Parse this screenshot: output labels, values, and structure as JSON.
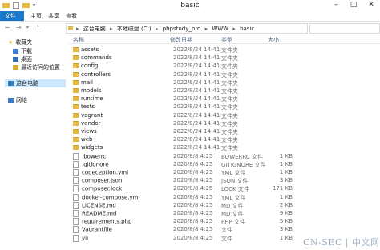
{
  "window": {
    "title": "basic",
    "controls": [
      "–",
      "□",
      "✕"
    ]
  },
  "ribbon": {
    "tabs": [
      "文件",
      "主页",
      "共享",
      "查看"
    ]
  },
  "address": {
    "crumbs": [
      "这台电脑",
      "本地磁盘 (C:)",
      "phpstudy_pro",
      "WWW",
      "basic"
    ]
  },
  "columns": {
    "name": "名称",
    "date": "修改日期",
    "type": "类型",
    "size": "大小"
  },
  "sidebar": {
    "items": [
      {
        "label": "收藏夹",
        "icon": "star-icon"
      },
      {
        "label": "下载",
        "icon": "download-icon"
      },
      {
        "label": "桌面",
        "icon": "desktop-icon"
      },
      {
        "label": "最近访问的位置",
        "icon": "recent-icon"
      },
      {
        "label": "这台电脑",
        "icon": "computer-icon"
      },
      {
        "label": "网络",
        "icon": "network-icon"
      }
    ]
  },
  "files": [
    {
      "name": "assets",
      "date": "2022/8/24 14:41",
      "type": "文件夹",
      "size": "",
      "kind": "folder"
    },
    {
      "name": "commands",
      "date": "2022/8/24 14:41",
      "type": "文件夹",
      "size": "",
      "kind": "folder"
    },
    {
      "name": "config",
      "date": "2022/8/24 14:41",
      "type": "文件夹",
      "size": "",
      "kind": "folder"
    },
    {
      "name": "controllers",
      "date": "2022/8/24 14:41",
      "type": "文件夹",
      "size": "",
      "kind": "folder"
    },
    {
      "name": "mail",
      "date": "2022/8/24 14:41",
      "type": "文件夹",
      "size": "",
      "kind": "folder"
    },
    {
      "name": "models",
      "date": "2022/8/24 14:41",
      "type": "文件夹",
      "size": "",
      "kind": "folder"
    },
    {
      "name": "runtime",
      "date": "2022/8/24 14:41",
      "type": "文件夹",
      "size": "",
      "kind": "folder"
    },
    {
      "name": "tests",
      "date": "2022/8/24 14:41",
      "type": "文件夹",
      "size": "",
      "kind": "folder"
    },
    {
      "name": "vagrant",
      "date": "2022/8/24 14:41",
      "type": "文件夹",
      "size": "",
      "kind": "folder"
    },
    {
      "name": "vendor",
      "date": "2022/8/24 14:41",
      "type": "文件夹",
      "size": "",
      "kind": "folder"
    },
    {
      "name": "views",
      "date": "2022/8/24 14:41",
      "type": "文件夹",
      "size": "",
      "kind": "folder"
    },
    {
      "name": "web",
      "date": "2022/8/24 14:41",
      "type": "文件夹",
      "size": "",
      "kind": "folder"
    },
    {
      "name": "widgets",
      "date": "2022/8/24 14:41",
      "type": "文件夹",
      "size": "",
      "kind": "folder"
    },
    {
      "name": ".bowerrc",
      "date": "2020/8/8 4:25",
      "type": "BOWERRC 文件",
      "size": "1 KB",
      "kind": "file"
    },
    {
      "name": ".gitignore",
      "date": "2020/8/8 4:25",
      "type": "GITIGNORE 文件",
      "size": "1 KB",
      "kind": "file"
    },
    {
      "name": "codeception.yml",
      "date": "2020/8/8 4:25",
      "type": "YML 文件",
      "size": "1 KB",
      "kind": "file"
    },
    {
      "name": "composer.json",
      "date": "2020/8/8 4:25",
      "type": "JSON 文件",
      "size": "3 KB",
      "kind": "file"
    },
    {
      "name": "composer.lock",
      "date": "2020/8/8 4:25",
      "type": "LOCK 文件",
      "size": "171 KB",
      "kind": "file"
    },
    {
      "name": "docker-compose.yml",
      "date": "2020/8/8 4:25",
      "type": "YML 文件",
      "size": "1 KB",
      "kind": "file"
    },
    {
      "name": "LICENSE.md",
      "date": "2020/8/8 4:25",
      "type": "MD 文件",
      "size": "2 KB",
      "kind": "file"
    },
    {
      "name": "README.md",
      "date": "2020/8/8 4:25",
      "type": "MD 文件",
      "size": "9 KB",
      "kind": "file"
    },
    {
      "name": "requirements.php",
      "date": "2020/8/8 4:25",
      "type": "PHP 文件",
      "size": "5 KB",
      "kind": "file"
    },
    {
      "name": "Vagrantfile",
      "date": "2020/8/8 4:25",
      "type": "文件",
      "size": "3 KB",
      "kind": "file"
    },
    {
      "name": "yii",
      "date": "2020/8/8 4:25",
      "type": "文件",
      "size": "1 KB",
      "kind": "file"
    }
  ],
  "watermark": "CN-SEC | 中文网",
  "colors": {
    "folder": "#e8b93f",
    "file_tab": "#1979ca",
    "selection": "#cce8ff"
  }
}
